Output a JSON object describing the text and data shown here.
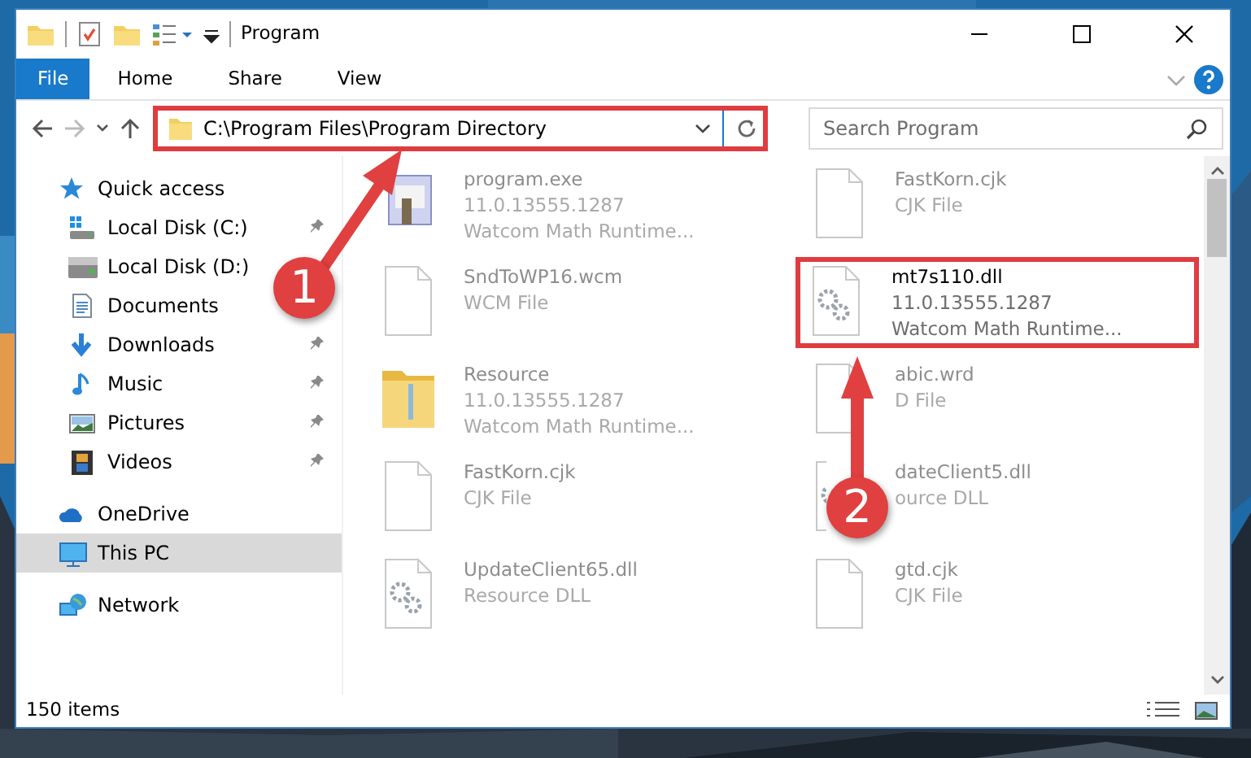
{
  "window": {
    "title": "Program"
  },
  "ribbon_tabs": [
    {
      "label": "File",
      "kind": "file",
      "selected": false
    },
    {
      "label": "Home",
      "kind": "tab",
      "selected": false
    },
    {
      "label": "Share",
      "kind": "tab",
      "selected": false
    },
    {
      "label": "View",
      "kind": "tab",
      "selected": false
    }
  ],
  "address_bar": {
    "path": "C:\\Program Files\\Program Directory"
  },
  "search": {
    "placeholder": "Search Program"
  },
  "sidebar": {
    "items": [
      {
        "label": "Quick access",
        "kind": "star",
        "selected": false,
        "children": [
          {
            "label": "Local Disk (C:)",
            "kind": "sysdrive",
            "pinned": true,
            "selected": false
          },
          {
            "label": "Local Disk (D:)",
            "kind": "drive",
            "pinned": false,
            "selected": false
          },
          {
            "label": "Documents",
            "kind": "documents",
            "pinned": false,
            "selected": false
          },
          {
            "label": "Downloads",
            "kind": "downloads",
            "pinned": true,
            "selected": false
          },
          {
            "label": "Music",
            "kind": "music",
            "pinned": true,
            "selected": false
          },
          {
            "label": "Pictures",
            "kind": "pictures",
            "pinned": true,
            "selected": false
          },
          {
            "label": "Videos",
            "kind": "videos",
            "pinned": true,
            "selected": false
          }
        ]
      },
      {
        "label": "OneDrive",
        "kind": "cloud",
        "selected": false
      },
      {
        "label": "This PC",
        "kind": "pc",
        "selected": true
      },
      {
        "label": "Network",
        "kind": "network",
        "selected": false
      }
    ]
  },
  "files": [
    {
      "name": "program.exe",
      "details": [
        "11.0.13555.1287",
        "Watcom Math Runtime..."
      ],
      "kind": "exe",
      "blurred": true
    },
    {
      "name": "FastKorn.cjk",
      "details": [
        "CJK File"
      ],
      "kind": "file",
      "blurred": true
    },
    {
      "name": "SndToWP16.wcm",
      "details": [
        "WCM File"
      ],
      "kind": "file",
      "blurred": true
    },
    {
      "name": "mt7s110.dll",
      "details": [
        "11.0.13555.1287",
        "Watcom Math Runtime..."
      ],
      "kind": "dll",
      "blurred": false
    },
    {
      "name": "Resource",
      "details": [
        "11.0.13555.1287",
        "Watcom Math Runtime..."
      ],
      "kind": "folder",
      "blurred": true
    },
    {
      "name": "abic.wrd",
      "details": [
        "D File"
      ],
      "kind": "file",
      "blurred": true
    },
    {
      "name": "FastKorn.cjk",
      "details": [
        "CJK File"
      ],
      "kind": "file",
      "blurred": true
    },
    {
      "name": "dateClient5.dll",
      "details": [
        "ource DLL"
      ],
      "kind": "dll",
      "blurred": true
    },
    {
      "name": "UpdateClient65.dll",
      "details": [
        "Resource DLL"
      ],
      "kind": "dll",
      "blurred": true
    },
    {
      "name": "gtd.cjk",
      "details": [
        "CJK File"
      ],
      "kind": "file",
      "blurred": true
    }
  ],
  "status_bar": {
    "text": "150 items"
  },
  "annotations": [
    {
      "label": "1"
    },
    {
      "label": "2"
    }
  ]
}
